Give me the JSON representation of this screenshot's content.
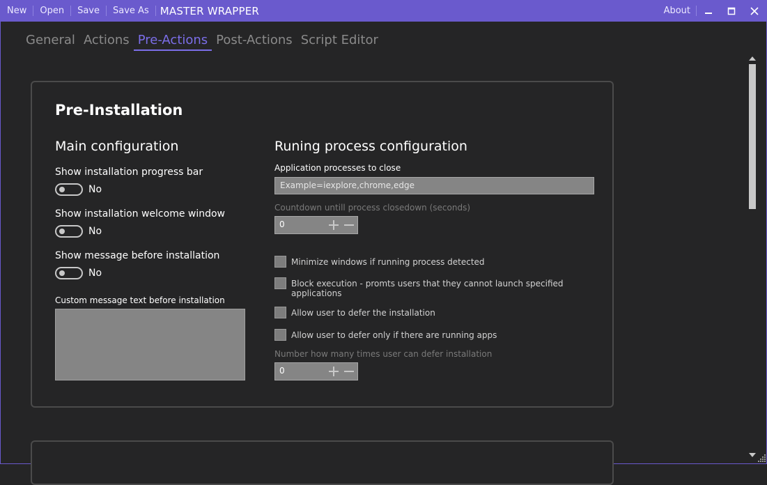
{
  "titlebar": {
    "buttons": [
      "New",
      "Open",
      "Save",
      "Save As"
    ],
    "title": "MASTER WRAPPER",
    "about": "About",
    "accent_color": "#6a5acd"
  },
  "tabs": [
    {
      "label": "General",
      "active": false
    },
    {
      "label": "Actions",
      "active": false
    },
    {
      "label": "Pre-Actions",
      "active": true
    },
    {
      "label": "Post-Actions",
      "active": false
    },
    {
      "label": "Script Editor",
      "active": false
    }
  ],
  "card": {
    "title": "Pre-Installation",
    "main_config": {
      "heading": "Main configuration",
      "toggles": [
        {
          "label": "Show installation progress bar",
          "state": "No"
        },
        {
          "label": "Show installation welcome window",
          "state": "No"
        },
        {
          "label": "Show message before installation",
          "state": "No"
        }
      ],
      "custom_message_label": "Custom message text before installation",
      "custom_message_value": ""
    },
    "process_config": {
      "heading": "Runing process configuration",
      "processes_label": "Application processes to close",
      "processes_placeholder": "Example=iexplore,chrome,edge",
      "countdown_label": "Countdown untill process closedown (seconds)",
      "countdown_value": "0",
      "checkboxes": [
        {
          "label": "Minimize windows if running process detected",
          "checked": false
        },
        {
          "label": "Block execution - promts users that they cannot launch specified applications",
          "checked": false
        },
        {
          "label": "Allow user to defer the installation",
          "checked": false
        },
        {
          "label": "Allow user to defer only if there are running apps",
          "checked": false
        }
      ],
      "defer_count_label": "Number how many times user can defer installation",
      "defer_count_value": "0"
    }
  },
  "icons": [
    "minimize-icon",
    "maximize-icon",
    "close-icon",
    "plus-icon",
    "minus-icon",
    "scroll-up-icon",
    "scroll-down-icon",
    "resize-grip-icon"
  ]
}
